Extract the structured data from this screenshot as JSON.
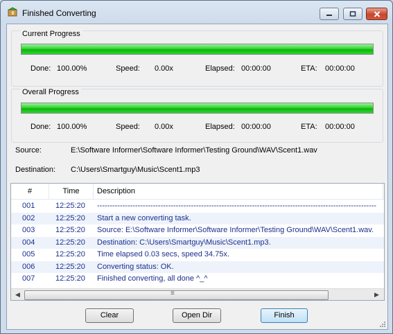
{
  "window": {
    "title": "Finished Converting"
  },
  "current": {
    "title": "Current Progress",
    "progress": 1.0,
    "done_label": "Done:",
    "done_value": "100.00%",
    "speed_label": "Speed:",
    "speed_value": "0.00x",
    "elapsed_label": "Elapsed:",
    "elapsed_value": "00:00:00",
    "eta_label": "ETA:",
    "eta_value": "00:00:00"
  },
  "overall": {
    "title": "Overall Progress",
    "progress": 1.0,
    "done_label": "Done:",
    "done_value": "100.00%",
    "speed_label": "Speed:",
    "speed_value": "0.00x",
    "elapsed_label": "Elapsed:",
    "elapsed_value": "00:00:00",
    "eta_label": "ETA:",
    "eta_value": "00:00:00"
  },
  "source": {
    "label": "Source:",
    "value": "E:\\Software Informer\\Software Informer\\Testing Ground\\WAV\\Scent1.wav"
  },
  "destination": {
    "label": "Destination:",
    "value": "C:\\Users\\Smartguy\\Music\\Scent1.mp3"
  },
  "log": {
    "headers": [
      "#",
      "Time",
      "Description"
    ],
    "rows": [
      {
        "num": "001",
        "time": "12:25:20",
        "desc": "--------------------------------------------------------------------------------------------------------------"
      },
      {
        "num": "002",
        "time": "12:25:20",
        "desc": "Start a new converting task."
      },
      {
        "num": "003",
        "time": "12:25:20",
        "desc": "Source:  E:\\Software Informer\\Software Informer\\Testing Ground\\WAV\\Scent1.wav."
      },
      {
        "num": "004",
        "time": "12:25:20",
        "desc": "Destination: C:\\Users\\Smartguy\\Music\\Scent1.mp3."
      },
      {
        "num": "005",
        "time": "12:25:20",
        "desc": "Time elapsed 0.03 secs, speed 34.75x."
      },
      {
        "num": "006",
        "time": "12:25:20",
        "desc": "Converting status: OK."
      },
      {
        "num": "007",
        "time": "12:25:20",
        "desc": "Finished converting, all done ^_^"
      }
    ]
  },
  "buttons": {
    "clear": "Clear",
    "open_dir": "Open Dir",
    "finish": "Finish"
  },
  "icons": {
    "minimize": "minimize-icon",
    "maximize": "maximize-icon",
    "close": "close-icon",
    "scroll_grip": "≡"
  }
}
